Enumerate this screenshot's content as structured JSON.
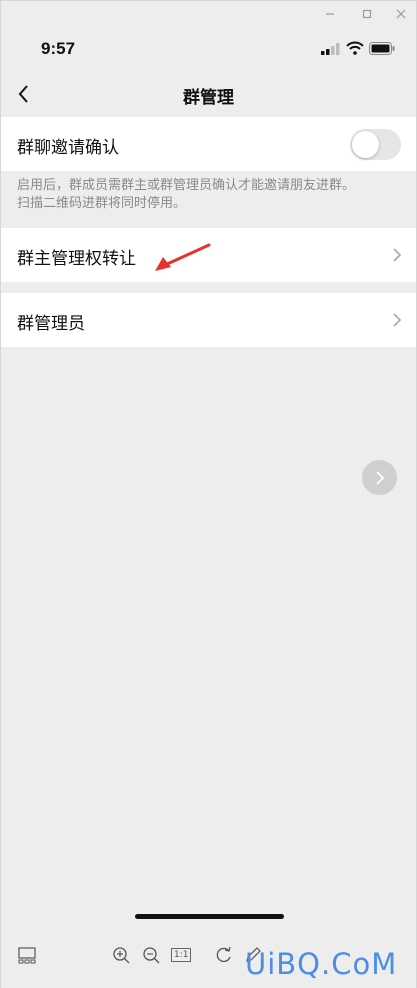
{
  "status_bar": {
    "time": "9:57"
  },
  "nav": {
    "title": "群管理"
  },
  "settings": {
    "invite_confirm": {
      "label": "群聊邀请确认",
      "enabled": false
    },
    "invite_desc_line1": "启用后，群成员需群主或群管理员确认才能邀请朋友进群。",
    "invite_desc_line2": "扫描二维码进群将同时停用。",
    "transfer_owner": {
      "label": "群主管理权转让"
    },
    "admins": {
      "label": "群管理员"
    }
  },
  "toolbar": {
    "actual_size": "1:1"
  },
  "watermark": "UiBQ.CoM",
  "colors": {
    "background": "#ededed",
    "cell": "#ffffff",
    "annotation_arrow": "#e8312b",
    "watermark": "#4c8de8"
  }
}
